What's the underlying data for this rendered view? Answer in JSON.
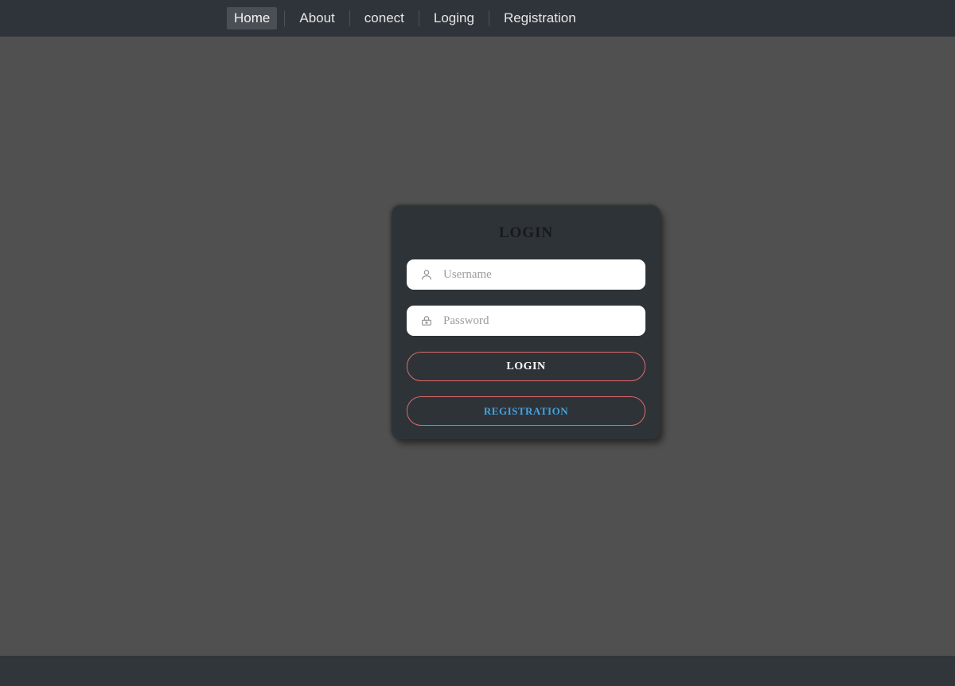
{
  "nav": {
    "items": [
      {
        "label": "Home",
        "active": true
      },
      {
        "label": "About",
        "active": false
      },
      {
        "label": "conect",
        "active": false
      },
      {
        "label": "Loging",
        "active": false
      },
      {
        "label": "Registration",
        "active": false
      }
    ]
  },
  "login_form": {
    "title": "LOGIN",
    "username": {
      "placeholder": "Username",
      "value": "",
      "icon": "user-icon"
    },
    "password": {
      "placeholder": "Password",
      "value": "",
      "icon": "lock-icon"
    },
    "login_button_label": "LOGIN",
    "registration_button_label": "REGISTRATION"
  },
  "colors": {
    "page_background": "#505050",
    "navbar_background": "#2f343a",
    "nav_active_background": "#4a4f55",
    "card_background": "#2e3338",
    "card_title": "#17191c",
    "input_background": "#ffffff",
    "placeholder": "#9b9b9b",
    "button_border": "#e06a6a",
    "login_button_text": "#ffffff",
    "registration_button_text": "#45a1dd",
    "footer_background": "#31363b"
  }
}
